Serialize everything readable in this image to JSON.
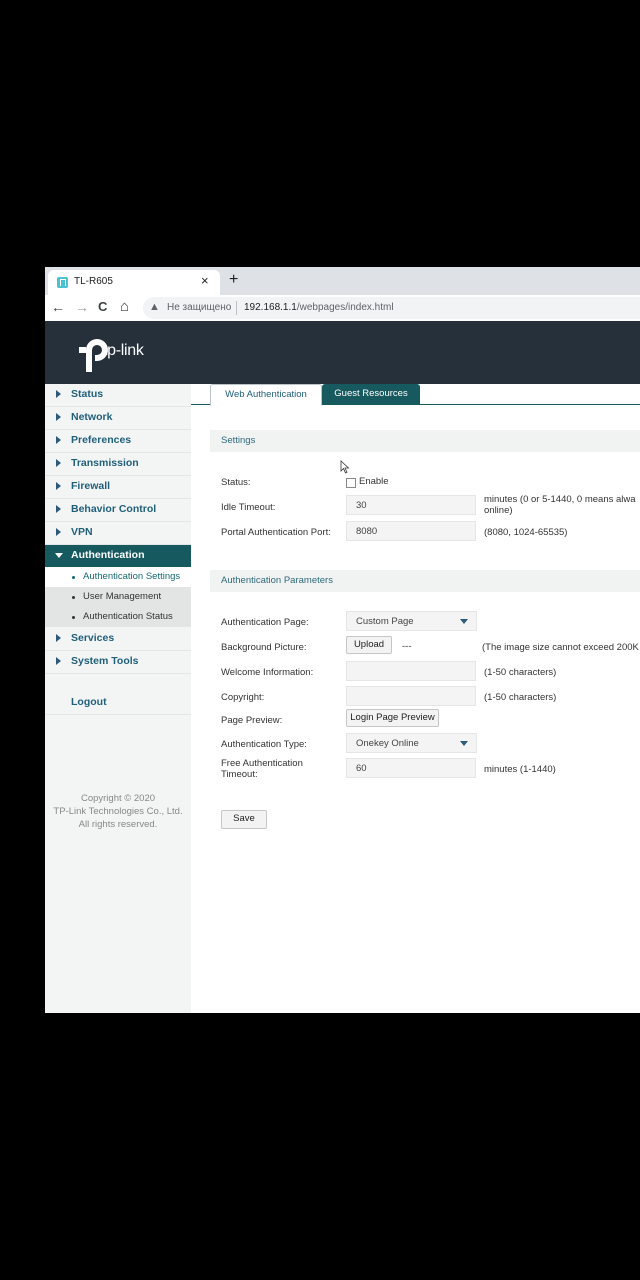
{
  "browser": {
    "tab_title": "TL-R605",
    "tab_close": "×",
    "new_tab": "+",
    "back": "←",
    "forward": "→",
    "reload": "C",
    "home": "⌂",
    "insecure_label": "Не защищено",
    "url_host": "192.168.1.1",
    "url_path": "/webpages/index.html"
  },
  "header": {
    "logo_text": "tp-link",
    "brand_color": "#26303a"
  },
  "sidebar": {
    "items": [
      {
        "label": "Status"
      },
      {
        "label": "Network"
      },
      {
        "label": "Preferences"
      },
      {
        "label": "Transmission"
      },
      {
        "label": "Firewall"
      },
      {
        "label": "Behavior Control"
      },
      {
        "label": "VPN"
      },
      {
        "label": "Authentication"
      },
      {
        "label": "Services"
      },
      {
        "label": "System Tools"
      }
    ],
    "active_item": "Authentication",
    "subitems": [
      {
        "label": "Authentication Settings"
      },
      {
        "label": "User Management"
      },
      {
        "label": "Authentication Status"
      }
    ],
    "current_subitem": "Authentication Settings",
    "logout": "Logout",
    "copyright": [
      "Copyright © 2020",
      "TP-Link Technologies Co., Ltd.",
      "All rights reserved."
    ]
  },
  "tabs": [
    {
      "label": "Web Authentication",
      "selected": true
    },
    {
      "label": "Guest Resources",
      "selected": false
    }
  ],
  "settings": {
    "title": "Settings",
    "status_label": "Status:",
    "status_option": "Enable",
    "status_checked": false,
    "idle_timeout_label": "Idle Timeout:",
    "idle_timeout_value": "30",
    "idle_timeout_hint_1": "minutes (0 or 5-1440, 0 means alwa",
    "idle_timeout_hint_2": "online)",
    "portal_port_label": "Portal Authentication Port:",
    "portal_port_value": "8080",
    "portal_port_hint": "(8080, 1024-65535)"
  },
  "auth_params": {
    "title": "Authentication Parameters",
    "auth_page_label": "Authentication Page:",
    "auth_page_value": "Custom Page",
    "bg_picture_label": "Background Picture:",
    "upload_button": "Upload",
    "bg_picture_value": "---",
    "bg_picture_hint": "(The image size cannot exceed 200K",
    "welcome_label": "Welcome Information:",
    "welcome_value": "",
    "welcome_hint": "(1-50 characters)",
    "copyright_label": "Copyright:",
    "copyright_value": "",
    "copyright_hint": "(1-50 characters)",
    "preview_label": "Page Preview:",
    "preview_button": "Login Page Preview",
    "auth_type_label": "Authentication Type:",
    "auth_type_value": "Onekey Online",
    "free_timeout_label_1": "Free Authentication",
    "free_timeout_label_2": "Timeout:",
    "free_timeout_value": "60",
    "free_timeout_hint": "minutes (1-1440)"
  },
  "save_button": "Save",
  "colors": {
    "accent": "#16595e",
    "link": "#1f5f7a"
  }
}
